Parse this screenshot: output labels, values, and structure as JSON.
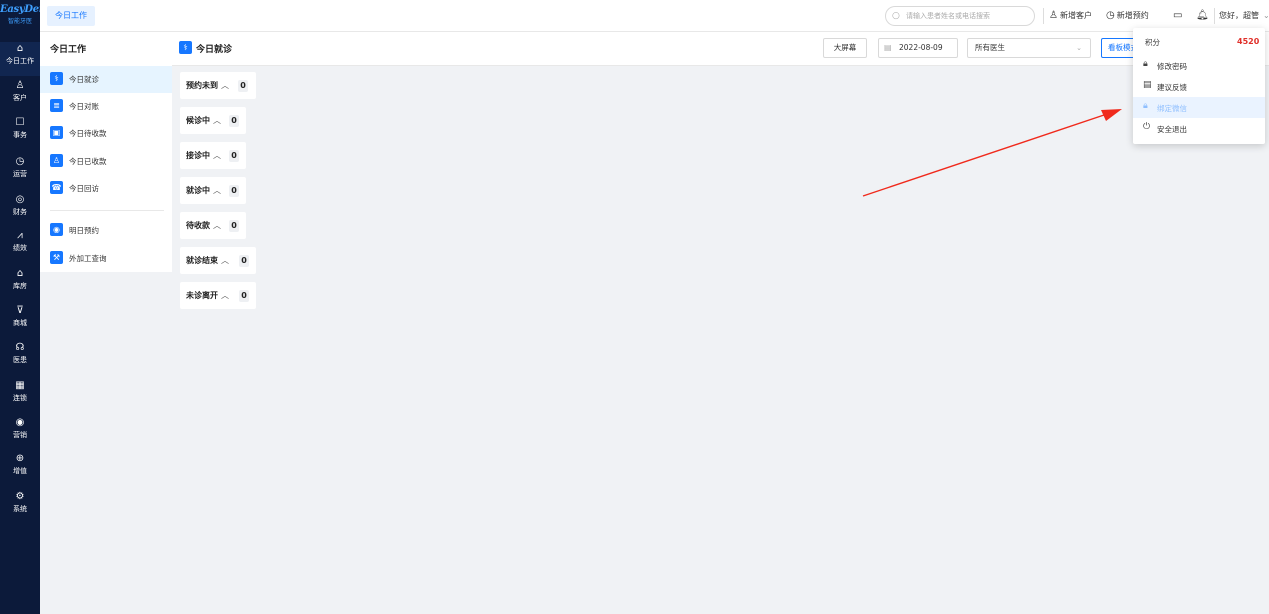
{
  "brand": {
    "name": "EasyDent",
    "sub": "智能牙医"
  },
  "rail": [
    {
      "icon": "home-icon",
      "glyph": "⌂",
      "label": "今日工作",
      "active": true
    },
    {
      "icon": "customer-icon",
      "glyph": "♙",
      "label": "客户"
    },
    {
      "icon": "task-icon",
      "glyph": "☐",
      "label": "事务"
    },
    {
      "icon": "clock-icon",
      "glyph": "◷",
      "label": "运营"
    },
    {
      "icon": "finance-icon",
      "glyph": "◎",
      "label": "财务"
    },
    {
      "icon": "chart-icon",
      "glyph": "⩘",
      "label": "绩效"
    },
    {
      "icon": "warehouse-icon",
      "glyph": "⌂",
      "label": "库房"
    },
    {
      "icon": "cart-icon",
      "glyph": "⊽",
      "label": "商城"
    },
    {
      "icon": "doctor-icon",
      "glyph": "☊",
      "label": "医患"
    },
    {
      "icon": "chain-icon",
      "glyph": "▦",
      "label": "连锁"
    },
    {
      "icon": "marketing-icon",
      "glyph": "◉",
      "label": "营销"
    },
    {
      "icon": "value-added-icon",
      "glyph": "⊕",
      "label": "增值"
    },
    {
      "icon": "settings-icon",
      "glyph": "⚙",
      "label": "系统"
    }
  ],
  "topbar": {
    "tab": "今日工作",
    "search_placeholder": "请输入患者姓名或电话搜索",
    "new_customer": "新增客户",
    "new_appointment": "新增预约",
    "greeting": "您好，超管"
  },
  "subnav": {
    "title": "今日工作",
    "items": [
      {
        "icon": "visit-icon",
        "label": "今日就诊",
        "active": true
      },
      {
        "icon": "reconcile-icon",
        "label": "今日对账"
      },
      {
        "icon": "pending-payment-icon",
        "label": "今日待收款"
      },
      {
        "icon": "received-payment-icon",
        "label": "今日已收款"
      },
      {
        "icon": "follow-up-icon",
        "label": "今日回访"
      },
      {
        "icon": "tomorrow-appointment-icon",
        "label": "明日预约"
      },
      {
        "icon": "outsourcing-icon",
        "label": "外加工查询"
      }
    ]
  },
  "main": {
    "title": "今日就诊",
    "big_screen": "大屏幕",
    "date": "2022-08-09",
    "doctor_select": "所有医生",
    "board_button": "看板模式",
    "groups": [
      {
        "label": "预约未到",
        "count": "0"
      },
      {
        "label": "候诊中",
        "count": "0"
      },
      {
        "label": "接诊中",
        "count": "0"
      },
      {
        "label": "就诊中",
        "count": "0"
      },
      {
        "label": "待收款",
        "count": "0"
      },
      {
        "label": "就诊结束",
        "count": "0"
      },
      {
        "label": "未诊离开",
        "count": "0"
      }
    ]
  },
  "dropdown": {
    "points_label": "积分",
    "points_value": "4520",
    "items": [
      {
        "icon": "lock-icon",
        "glyph": "🔒︎",
        "label": "修改密码"
      },
      {
        "icon": "feedback-icon",
        "glyph": "▤",
        "label": "建议反馈"
      },
      {
        "icon": "wechat-bind-icon",
        "glyph": "🔒︎",
        "label": "绑定微信",
        "highlight": true
      },
      {
        "icon": "power-icon",
        "glyph": "⏻",
        "label": "安全退出"
      }
    ]
  },
  "colors": {
    "rail_bg": "#0c1a3a",
    "accent": "#1677ff",
    "points": "#e0302a",
    "arrow": "#f02a1c"
  }
}
